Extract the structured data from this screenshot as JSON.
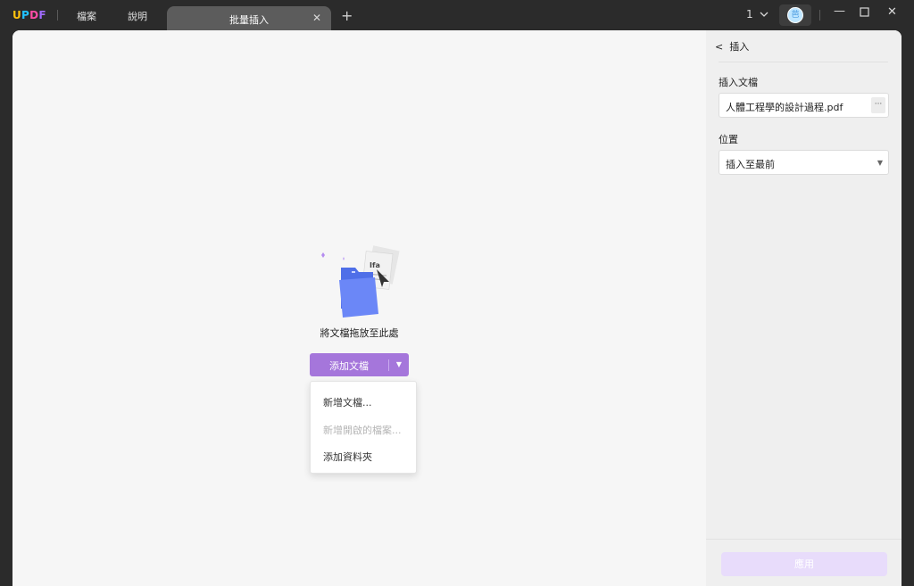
{
  "app": {
    "logo": "UPDF",
    "menu": [
      "檔案",
      "說明"
    ]
  },
  "tab": {
    "title": "批量插入",
    "close_icon": "close-icon",
    "add_icon": "plus-icon"
  },
  "toolbar": {
    "page_indicator": "1",
    "avatar_initial": "芭"
  },
  "main": {
    "drop_text": "將文檔拖放至此處",
    "add_button_label": "添加文檔",
    "dropdown": [
      {
        "label": "新增文檔...",
        "enabled": true
      },
      {
        "label": "新增開啟的檔案...",
        "enabled": false
      },
      {
        "label": "添加資料夾",
        "enabled": true
      }
    ]
  },
  "side": {
    "header": "插入",
    "insert_doc_label": "插入文檔",
    "insert_doc_value": "人體工程學的設計過程.pdf",
    "more_label": "···",
    "position_label": "位置",
    "position_value": "插入至最前",
    "apply_label": "應用"
  },
  "colors": {
    "accent": "#a576db",
    "apply_disabled": "#e8dcfb",
    "titlebar": "#2b2b2b"
  }
}
